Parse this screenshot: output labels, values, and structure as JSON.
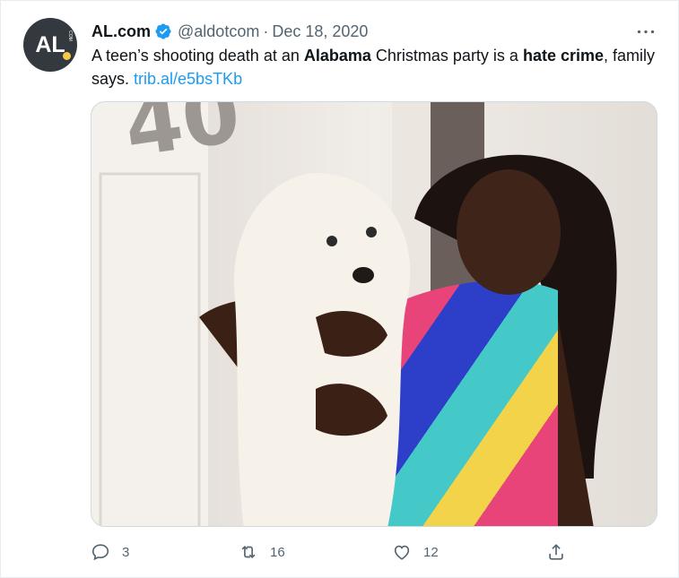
{
  "tweet": {
    "avatar_text": "AL",
    "avatar_sub": "COM",
    "name": "AL.com",
    "handle": "@aldotcom",
    "separator": "·",
    "date": "Dec 18, 2020",
    "text": {
      "p1": "A teen’s shooting death at an ",
      "b1": "Alabama",
      "p2": " Christmas party is a ",
      "b2": "hate crime",
      "p3": ", family says. ",
      "link": "trib.al/e5bsTKb"
    },
    "media_sign": "40",
    "actions": {
      "reply_count": "3",
      "retweet_count": "16",
      "like_count": "12"
    }
  },
  "colors": {
    "accent": "#1d9bf0",
    "muted": "#536471",
    "text": "#0f1419",
    "avatar_bg": "#33393f",
    "avatar_dot": "#f7c948"
  },
  "icons": {
    "verified": "verified-badge-icon",
    "more": "more-horizontal-icon",
    "reply": "reply-icon",
    "retweet": "retweet-icon",
    "like": "heart-icon",
    "share": "share-icon"
  }
}
